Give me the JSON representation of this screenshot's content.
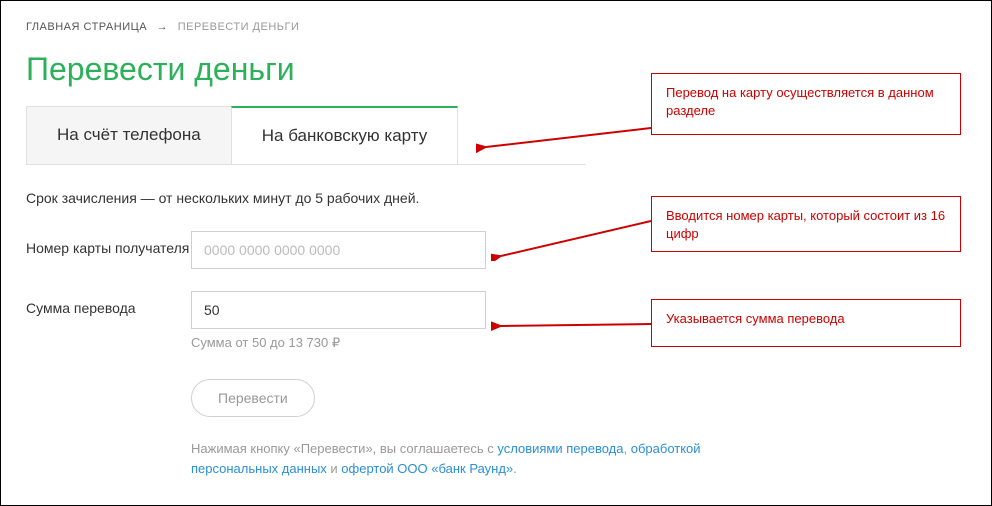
{
  "breadcrumb": {
    "home": "ГЛАВНАЯ СТРАНИЦА",
    "arrow": "→",
    "current": "ПЕРЕВЕСТИ ДЕНЬГИ"
  },
  "page_title": "Перевести деньги",
  "tabs": {
    "phone": "На счёт телефона",
    "card": "На банковскую карту"
  },
  "info": "Срок зачисления — от нескольких минут до 5 рабочих дней.",
  "form": {
    "card_label": "Номер карты получателя",
    "card_placeholder": "0000 0000 0000 0000",
    "sum_label": "Сумма перевода",
    "sum_value": "50",
    "sum_hint": "Сумма от 50 до 13 730 ₽",
    "submit": "Перевести"
  },
  "disclaimer": {
    "prefix": "Нажимая кнопку «Перевести», вы соглашаетесь с ",
    "link1": "условиями перевода",
    "sep1": ", ",
    "link2": "обработкой персональных данных",
    "sep2": " и ",
    "link3": "офертой ООО «банк Раунд»",
    "suffix": "."
  },
  "callouts": {
    "c1": "Перевод на карту осуществляется в данном разделе",
    "c2": "Вводится номер карты, который состоит из 16 цифр",
    "c3": "Указывается сумма перевода"
  }
}
